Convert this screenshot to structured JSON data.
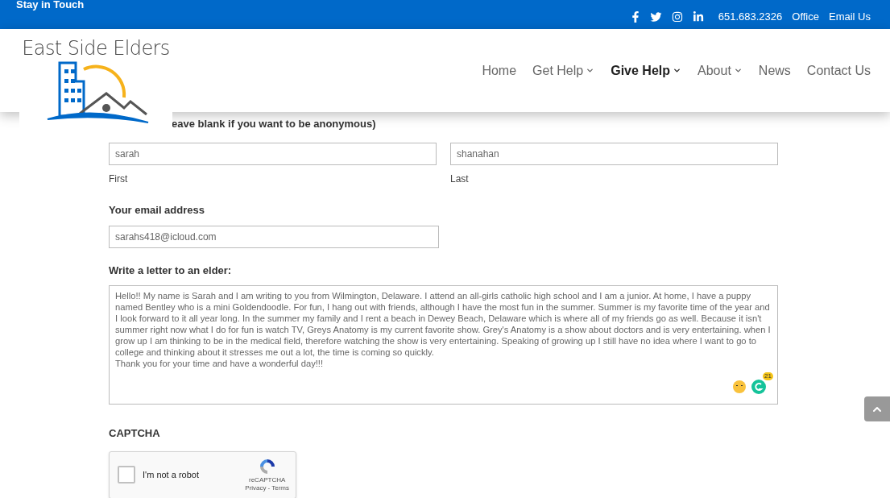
{
  "top_bar": {
    "tagline": "Stay in Touch",
    "phone": "651.683.2326",
    "links": [
      "Office",
      "Email Us"
    ]
  },
  "logo": {
    "name": "East Side Elders"
  },
  "nav": [
    {
      "label": "Home",
      "selected": false,
      "dropdown": false
    },
    {
      "label": "Get Help",
      "selected": false,
      "dropdown": true
    },
    {
      "label": "Give Help",
      "selected": true,
      "dropdown": true
    },
    {
      "label": "About",
      "selected": false,
      "dropdown": true
    },
    {
      "label": "News",
      "selected": false,
      "dropdown": false
    },
    {
      "label": "Contact Us",
      "selected": false,
      "dropdown": false
    }
  ],
  "form": {
    "name_label": "eave blank if you want to be anonymous)",
    "first": {
      "value": "sarah",
      "sublabel": "First"
    },
    "last": {
      "value": "shanahan",
      "sublabel": "Last"
    },
    "email_label": "Your email address",
    "email": {
      "value": "sarahs418@icloud.com"
    },
    "letter_label": "Write a letter to an elder:",
    "letter": {
      "value": "Hello!! My name is Sarah and I am writing to you from Wilmington, Delaware. I attend an all-girls catholic high school and I am a junior. At home, I have a puppy named Bentley who is a mini Goldendoodle. For fun, I hang out with friends, although I have the most fun in the summer. Summer is my favorite time of the year and I look forward to it all year long. In the summer my family and I rent a beach in Dewey Beach, Delaware which is where all of my friends go as well. Because it isn't summer right now what I do for fun is watch TV, Greys Anatomy is my current favorite show. Grey's Anatomy is a show about doctors and is very entertaining. when I grow up I am thinking to be in the medical field, therefore watching the show is very entertaining. Speaking of growing up I still have no idea where I want to go to college and thinking about it stresses me out a lot, the time is coming so quickly.\nThank you for your time and have a wonderful day!!!",
      "grammar_count": "21"
    },
    "captcha_label": "CAPTCHA",
    "captcha": {
      "checked": false,
      "label": "I'm not a robot",
      "brand": "reCAPTCHA",
      "privacy": "Privacy",
      "separator": "-",
      "terms": "Terms"
    }
  }
}
